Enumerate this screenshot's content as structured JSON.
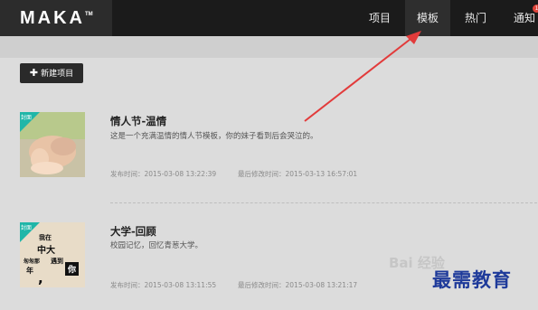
{
  "header": {
    "logo": "MAKA",
    "logo_tm": "TM",
    "nav": [
      "项目",
      "模板",
      "热门",
      "通知"
    ],
    "notice_count": "1"
  },
  "toolbar": {
    "new_project_label": "新建项目",
    "plus": "✚"
  },
  "items": [
    {
      "badge": "封面",
      "title": "情人节-温情",
      "description": "这是一个充满温情的情人节模板，你的妹子看到后会哭泣的。",
      "published": "发布时间：2015-03-08 13:22:39",
      "modified": "最后修改时间：2015-03-13 16:57:01"
    },
    {
      "badge": "封面",
      "title": "大学-回顾",
      "description": "校园记忆，回忆青葱大学。",
      "published": "发布时间：2015-03-08 13:11:55",
      "modified": "最后修改时间：2015-03-08 13:21:17",
      "poster_lines": [
        "我在",
        "中大",
        "遇到",
        "你",
        "匆匆那",
        "年"
      ]
    }
  ],
  "watermark": "最需教育",
  "watermark_faint": "Bai 经验",
  "colors": {
    "topbar": "#1b1b1b",
    "badge": "#1fb6a8",
    "arrow": "#e23b3b",
    "watermark": "#1e3a9a"
  }
}
